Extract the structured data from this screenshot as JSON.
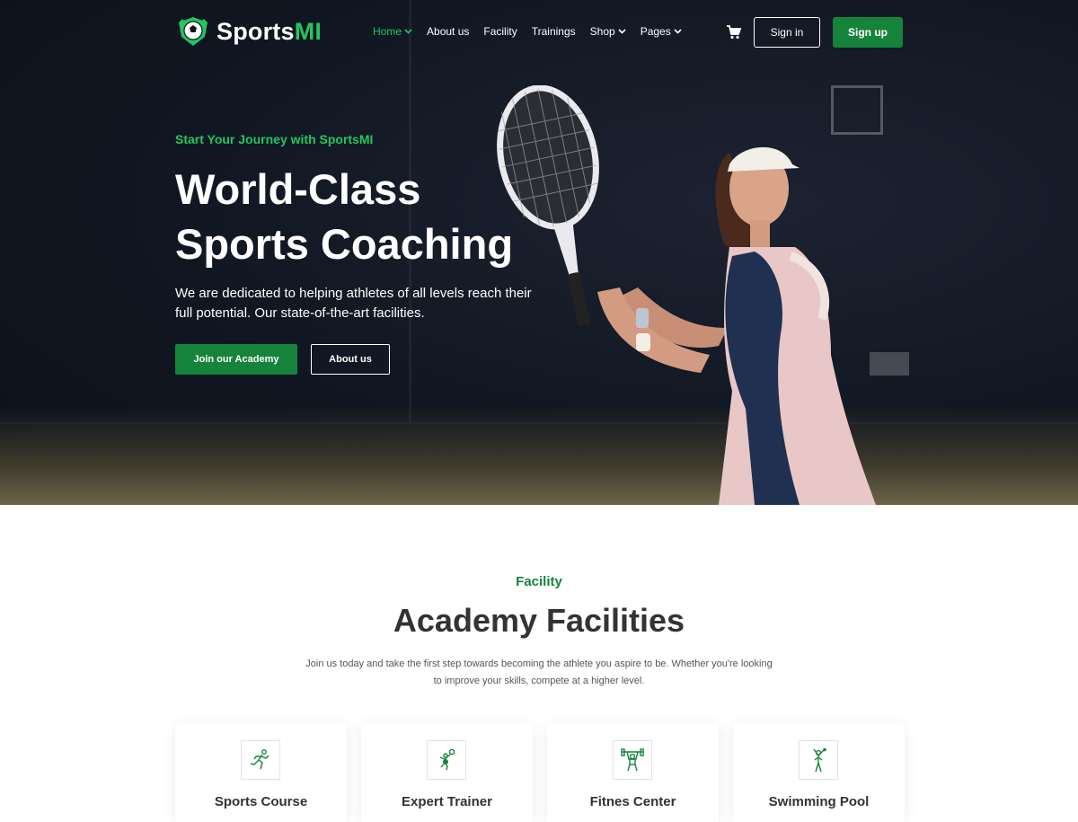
{
  "brand": {
    "name_main": "Sports",
    "name_accent": "MI"
  },
  "nav": {
    "items": [
      {
        "label": "Home",
        "dropdown": true,
        "active": true
      },
      {
        "label": "About us",
        "dropdown": false
      },
      {
        "label": "Facility",
        "dropdown": false
      },
      {
        "label": "Trainings",
        "dropdown": false
      },
      {
        "label": "Shop",
        "dropdown": true
      },
      {
        "label": "Pages",
        "dropdown": true
      }
    ],
    "cart_icon": "cart-icon",
    "signin_label": "Sign in",
    "signup_label": "Sign up"
  },
  "hero": {
    "eyebrow": "Start Your Journey with SportsMI",
    "title": "World-Class Sports Coaching",
    "description": "We are dedicated to helping athletes of all levels reach their full potential. Our state-of-the-art facilities.",
    "primary_button": "Join our Academy",
    "secondary_button": "About us"
  },
  "facility": {
    "eyebrow": "Facility",
    "title": "Academy Facilities",
    "description": "Join us today and take the first step towards becoming the athlete you aspire to be. Whether you're looking to improve your skills, compete at a higher level.",
    "cards": [
      {
        "title": "Sports Course",
        "icon": "runner-icon"
      },
      {
        "title": "Expert Trainer",
        "icon": "volleyball-player-icon"
      },
      {
        "title": "Fitnes Center",
        "icon": "weightlifter-icon"
      },
      {
        "title": "Swimming Pool",
        "icon": "athlete-icon"
      }
    ]
  },
  "colors": {
    "accent": "#22c55e",
    "brand_green": "#15843a",
    "hero_bg": "#111722"
  }
}
